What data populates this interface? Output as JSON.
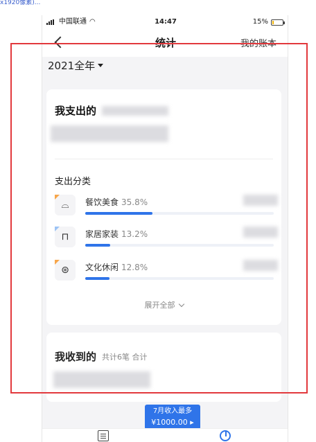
{
  "status_bar": {
    "carrier": "中国联通",
    "time": "14:47",
    "battery_pct": "15%",
    "battery_level": 0.15
  },
  "header": {
    "title": "统计",
    "my_account": "我的账本"
  },
  "period": {
    "label": "2021全年"
  },
  "expense_card": {
    "title": "我支出的",
    "section_title": "支出分类",
    "categories": [
      {
        "name": "餐饮美食",
        "percent": "35.8%",
        "ratio": 0.358,
        "icon": "dining-icon"
      },
      {
        "name": "家居家装",
        "percent": "13.2%",
        "ratio": 0.132,
        "icon": "sofa-icon"
      },
      {
        "name": "文化休闲",
        "percent": "12.8%",
        "ratio": 0.128,
        "icon": "film-reel-icon"
      }
    ],
    "expand_label": "展开全部"
  },
  "income_card": {
    "title": "我收到的",
    "note": "共计6笔 合计"
  },
  "highlight_badge": {
    "label": "7月收入最多",
    "amount": "¥1000.00 ▸"
  },
  "colors": {
    "accent": "#2f74e9",
    "highlight_frame": "#e2383c"
  }
}
